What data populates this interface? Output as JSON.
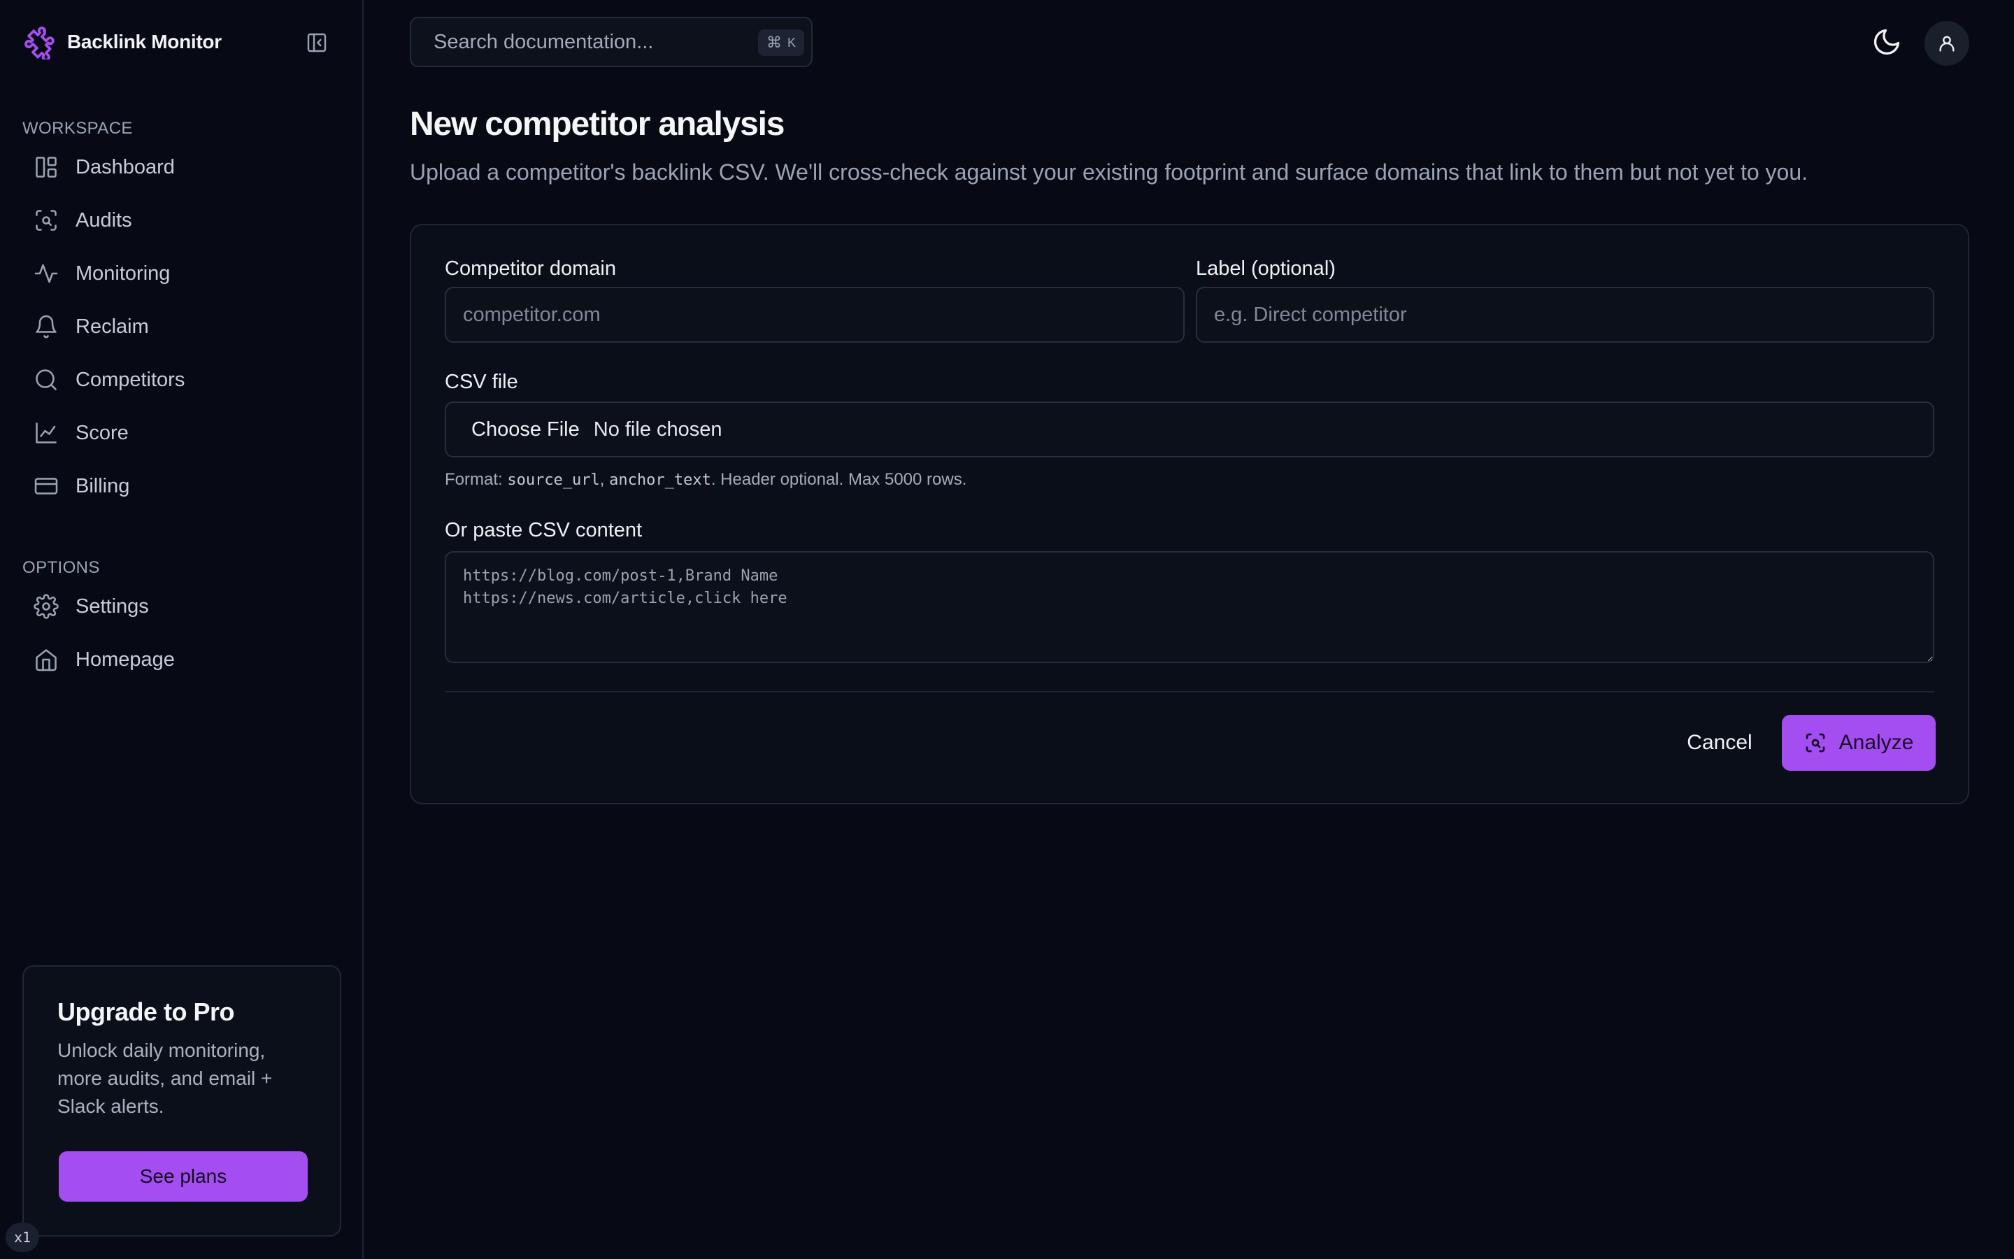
{
  "brand": {
    "name": "Backlink Monitor",
    "accent": "#a44df0"
  },
  "sidebar": {
    "workspace_label": "WORKSPACE",
    "options_label": "OPTIONS",
    "workspace_items": [
      {
        "label": "Dashboard",
        "icon": "dashboard-icon"
      },
      {
        "label": "Audits",
        "icon": "scan-icon"
      },
      {
        "label": "Monitoring",
        "icon": "activity-icon"
      },
      {
        "label": "Reclaim",
        "icon": "bell-icon"
      },
      {
        "label": "Competitors",
        "icon": "search-icon"
      },
      {
        "label": "Score",
        "icon": "chart-line-icon"
      },
      {
        "label": "Billing",
        "icon": "credit-card-icon"
      }
    ],
    "option_items": [
      {
        "label": "Settings",
        "icon": "gear-icon"
      },
      {
        "label": "Homepage",
        "icon": "home-icon"
      }
    ]
  },
  "upgrade": {
    "title": "Upgrade to Pro",
    "text": "Unlock daily monitoring, more audits, and email + Slack alerts.",
    "button": "See plans"
  },
  "zoom_badge": "x1",
  "topbar": {
    "search_placeholder": "Search documentation...",
    "shortcut_symbol": "⌘",
    "shortcut_key": "K"
  },
  "page": {
    "title": "New competitor analysis",
    "subtitle": "Upload a competitor's backlink CSV. We'll cross-check against your existing footprint and surface domains that link to them but not yet to you."
  },
  "form": {
    "domain_label": "Competitor domain",
    "domain_placeholder": "competitor.com",
    "label_label": "Label (optional)",
    "label_placeholder": "e.g. Direct competitor",
    "csv_label": "CSV file",
    "file_button": "Choose File",
    "file_status": "No file chosen",
    "hint_prefix": "Format: ",
    "hint_code_1": "source_url",
    "hint_sep": ", ",
    "hint_code_2": "anchor_text",
    "hint_suffix": ". Header optional. Max 5000 rows.",
    "paste_label": "Or paste CSV content",
    "paste_placeholder": "https://blog.com/post-1,Brand Name\nhttps://news.com/article,click here",
    "cancel": "Cancel",
    "analyze": "Analyze"
  }
}
